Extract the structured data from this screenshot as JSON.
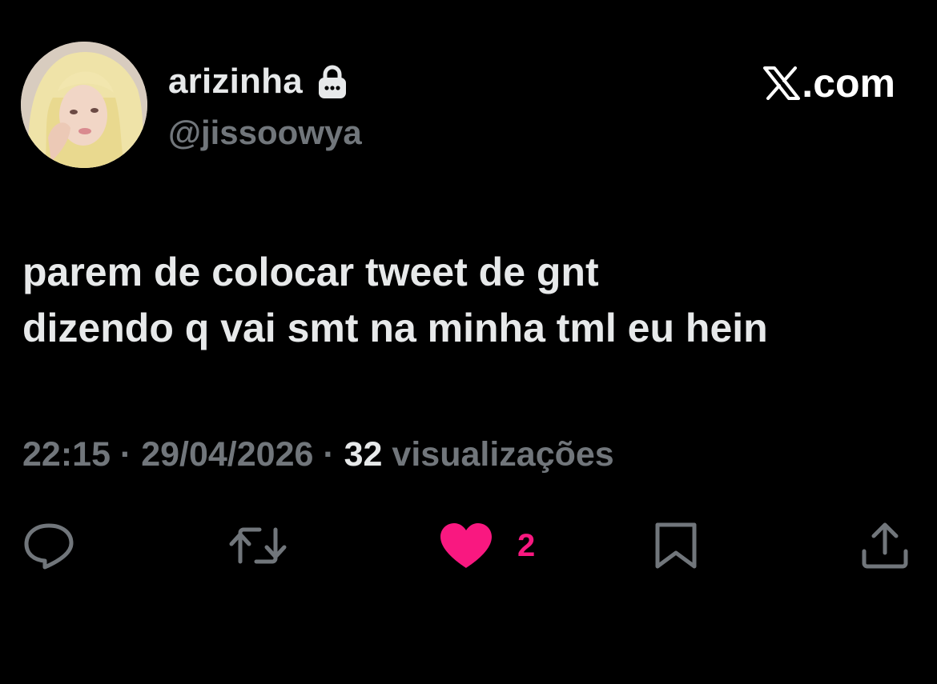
{
  "profile": {
    "display_name": "arizinha",
    "handle": "@jissoowya",
    "protected_icon": "lock-icon",
    "avatar_icon": "avatar"
  },
  "brand": {
    "logo_icon": "x-logo-icon",
    "text": ".com"
  },
  "tweet": {
    "lines": [
      "parem de colocar tweet de gnt",
      "dizendo q vai smt na minha tml eu hein"
    ]
  },
  "meta": {
    "time": "22:15",
    "separator": " · ",
    "date": "29/04/2026",
    "views_count": "32",
    "views_label": " visualizações"
  },
  "actions": {
    "reply_icon": "reply-icon",
    "retweet_icon": "retweet-icon",
    "like_icon": "heart-icon",
    "like_count": "2",
    "bookmark_icon": "bookmark-icon",
    "share_icon": "share-icon"
  },
  "colors": {
    "background": "#000000",
    "primary_text": "#e7e9ea",
    "secondary_text": "#71767b",
    "like_pink": "#f91880"
  }
}
